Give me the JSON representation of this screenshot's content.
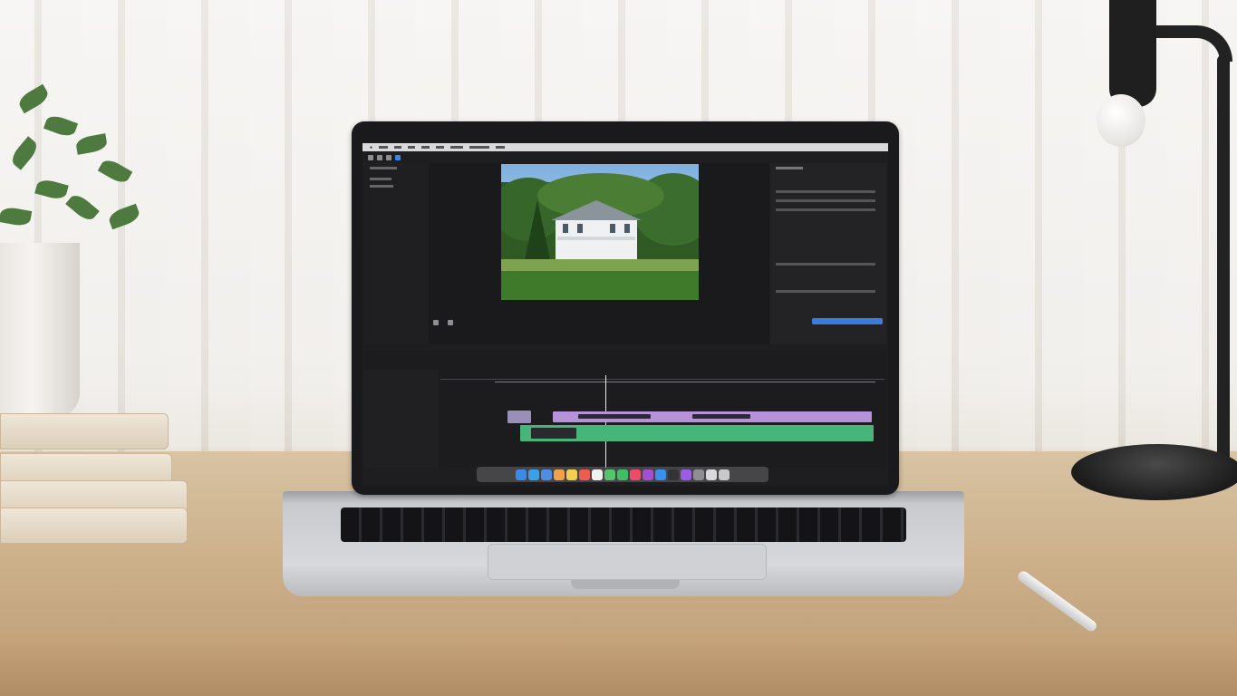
{
  "scene": {
    "description_colors": {
      "wall": "#efece8",
      "desk": "#cbb08a",
      "laptop_body": "#cfd1d4",
      "screen_bg": "#1e1e20"
    }
  },
  "app": {
    "menu_items": [
      "",
      "",
      "",
      "",
      "",
      "",
      "",
      ""
    ],
    "toolbar_icons": [
      "library-icon",
      "import-icon",
      "key-icon",
      "share-icon"
    ],
    "viewer": {
      "zoom_label": "",
      "timecode": ""
    },
    "inspector": {
      "title": ""
    },
    "timeline": {
      "clips_primary_color": "#b792d8",
      "clips_audio_color": "#47b57a",
      "playhead_color": "#e8e8e8",
      "range_line_color": "#e25a3a"
    },
    "dock_icons": [
      {
        "name": "finder-icon",
        "color": "#3d8ae6"
      },
      {
        "name": "safari-icon",
        "color": "#3aa1e6"
      },
      {
        "name": "mail-icon",
        "color": "#4f8de3"
      },
      {
        "name": "photos-icon",
        "color": "#f0a24a"
      },
      {
        "name": "notes-icon",
        "color": "#f2cf4d"
      },
      {
        "name": "calendar-icon",
        "color": "#ef5b4c"
      },
      {
        "name": "reminders-icon",
        "color": "#f1f1f1"
      },
      {
        "name": "messages-icon",
        "color": "#52c46a"
      },
      {
        "name": "facetime-icon",
        "color": "#3fbf63"
      },
      {
        "name": "music-icon",
        "color": "#ee4b6a"
      },
      {
        "name": "podcasts-icon",
        "color": "#a24fd6"
      },
      {
        "name": "appstore-icon",
        "color": "#3b8ff0"
      },
      {
        "name": "finalcut-icon",
        "color": "#333338"
      },
      {
        "name": "motion-icon",
        "color": "#9b5de5"
      },
      {
        "name": "settings-icon",
        "color": "#8e8e93"
      },
      {
        "name": "preview-icon",
        "color": "#d9d9dc"
      },
      {
        "name": "trash-icon",
        "color": "#c9c9cc"
      }
    ]
  }
}
